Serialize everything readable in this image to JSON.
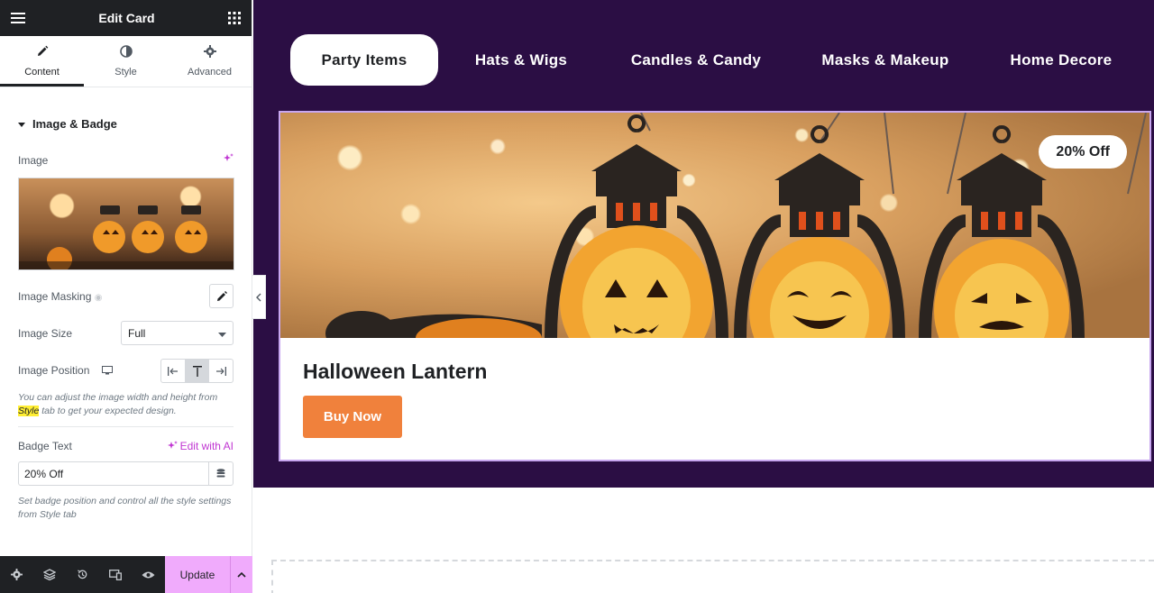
{
  "panel": {
    "title": "Edit Card",
    "tabs": [
      {
        "label": "Content",
        "icon": "pencil-icon"
      },
      {
        "label": "Style",
        "icon": "contrast-icon"
      },
      {
        "label": "Advanced",
        "icon": "gear-icon"
      }
    ],
    "section_title": "Image & Badge",
    "image_label": "Image",
    "image_masking_label": "Image Masking",
    "image_size_label": "Image Size",
    "image_size_value": "Full",
    "image_position_label": "Image Position",
    "image_help_pre": "You can adjust the image width and height from ",
    "image_help_highlight": "Style",
    "image_help_post": " tab to get your expected design.",
    "badge_text_label": "Badge Text",
    "edit_with_ai": "Edit with AI",
    "badge_text_value": "20% Off",
    "badge_help": "Set badge position and control all the style settings from Style tab",
    "update_label": "Update"
  },
  "nav": {
    "items": [
      "Party Items",
      "Hats & Wigs",
      "Candles & Candy",
      "Masks & Makeup",
      "Home Decore"
    ],
    "active_index": 0
  },
  "card": {
    "badge": "20% Off",
    "title": "Halloween Lantern",
    "button": "Buy Now"
  },
  "colors": {
    "stage_bg": "#2b0e44",
    "button_bg": "#f0813c",
    "update_bg": "#f0abfc",
    "ai_accent": "#c036d2"
  }
}
